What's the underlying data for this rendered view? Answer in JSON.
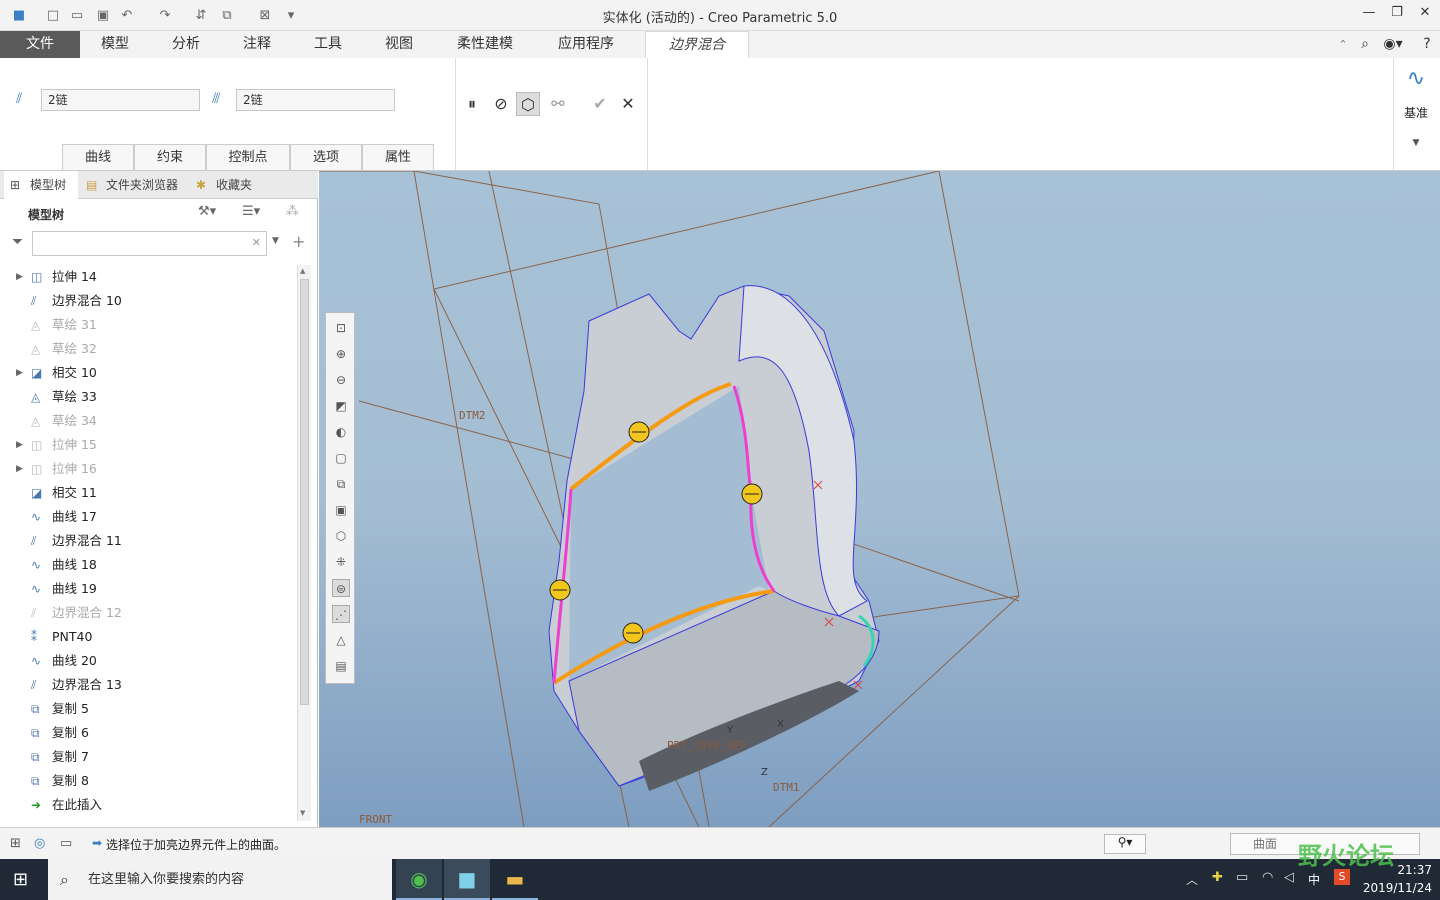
{
  "window": {
    "title": "实体化 (活动的) - Creo Parametric 5.0"
  },
  "menu": {
    "tabs": [
      "文件",
      "模型",
      "分析",
      "注释",
      "工具",
      "视图",
      "柔性建模",
      "应用程序",
      "边界混合"
    ]
  },
  "ribbon": {
    "chain1_value": "2链",
    "chain2_value": "2链",
    "tabs": [
      "曲线",
      "约束",
      "控制点",
      "选项",
      "属性"
    ],
    "datum_label": "基准"
  },
  "left_panel": {
    "tabs": [
      "模型树",
      "文件夹浏览器",
      "收藏夹"
    ],
    "tree_title": "模型树",
    "items": [
      {
        "label": "拉伸 14",
        "dim": false,
        "expandable": true,
        "icon": "extrude-icon"
      },
      {
        "label": "边界混合 10",
        "dim": false,
        "expandable": false,
        "icon": "boundary-blend-icon"
      },
      {
        "label": "草绘 31",
        "dim": true,
        "expandable": false,
        "icon": "sketch-icon"
      },
      {
        "label": "草绘 32",
        "dim": true,
        "expandable": false,
        "icon": "sketch-icon"
      },
      {
        "label": "相交 10",
        "dim": false,
        "expandable": true,
        "icon": "intersect-icon"
      },
      {
        "label": "草绘 33",
        "dim": false,
        "expandable": false,
        "icon": "sketch-icon"
      },
      {
        "label": "草绘 34",
        "dim": true,
        "expandable": false,
        "icon": "sketch-icon"
      },
      {
        "label": "拉伸 15",
        "dim": true,
        "expandable": true,
        "icon": "extrude-icon"
      },
      {
        "label": "拉伸 16",
        "dim": true,
        "expandable": true,
        "icon": "extrude-icon"
      },
      {
        "label": "相交 11",
        "dim": false,
        "expandable": false,
        "icon": "intersect-icon"
      },
      {
        "label": "曲线 17",
        "dim": false,
        "expandable": false,
        "icon": "curve-icon"
      },
      {
        "label": "边界混合 11",
        "dim": false,
        "expandable": false,
        "icon": "boundary-blend-icon"
      },
      {
        "label": "曲线 18",
        "dim": false,
        "expandable": false,
        "icon": "curve-icon"
      },
      {
        "label": "曲线 19",
        "dim": false,
        "expandable": false,
        "icon": "curve-icon"
      },
      {
        "label": "边界混合 12",
        "dim": true,
        "expandable": false,
        "icon": "boundary-blend-icon"
      },
      {
        "label": "PNT40",
        "dim": false,
        "expandable": false,
        "icon": "point-icon"
      },
      {
        "label": "曲线 20",
        "dim": false,
        "expandable": false,
        "icon": "curve-icon"
      },
      {
        "label": "边界混合 13",
        "dim": false,
        "expandable": false,
        "icon": "boundary-blend-icon"
      },
      {
        "label": "复制 5",
        "dim": false,
        "expandable": false,
        "icon": "copy-icon"
      },
      {
        "label": "复制 6",
        "dim": false,
        "expandable": false,
        "icon": "copy-icon"
      },
      {
        "label": "复制 7",
        "dim": false,
        "expandable": false,
        "icon": "copy-icon"
      },
      {
        "label": "复制 8",
        "dim": false,
        "expandable": false,
        "icon": "copy-icon"
      },
      {
        "label": "在此插入",
        "dim": false,
        "expandable": false,
        "icon": "insert-here-icon"
      }
    ]
  },
  "viewport": {
    "datum_labels": [
      "DTM2",
      "DTM1",
      "FRONT",
      "PRT_CSYS_DEF",
      "Y",
      "X",
      "Z"
    ]
  },
  "status": {
    "message": "选择位于加亮边界元件上的曲面。",
    "filter_value": "曲面"
  },
  "taskbar": {
    "search_placeholder": "在这里输入你要搜索的内容",
    "time": "21:37",
    "date": "2019/11/24",
    "ime": "中",
    "watermark": "野火论坛"
  }
}
